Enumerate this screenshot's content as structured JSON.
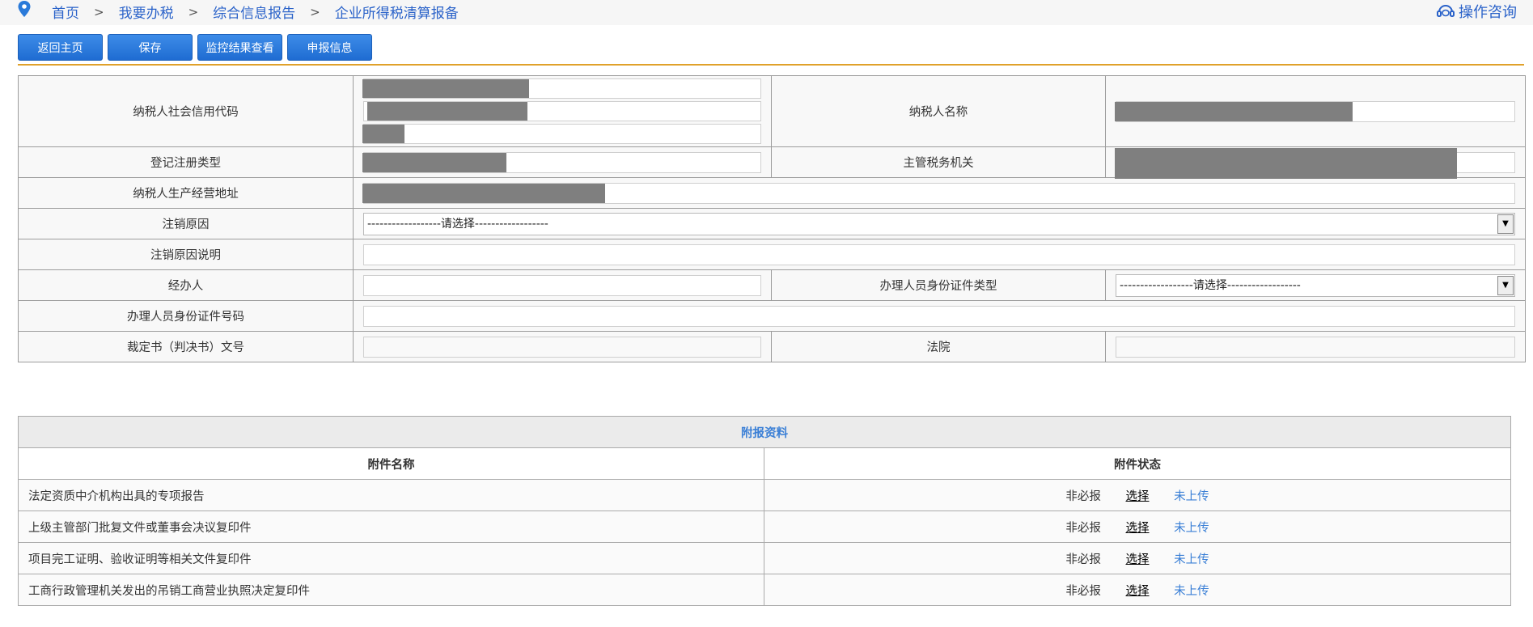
{
  "breadcrumb": {
    "items": [
      "首页",
      "我要办税",
      "综合信息报告",
      "企业所得税清算报备"
    ],
    "separator": ">"
  },
  "help": {
    "label": "操作咨询"
  },
  "toolbar": {
    "back_label": "返回主页",
    "save_label": "保存",
    "monitor_label": "监控结果查看",
    "declare_label": "申报信息"
  },
  "form": {
    "credit_code_label": "纳税人社会信用代码",
    "taxpayer_name_label": "纳税人名称",
    "reg_type_label": "登记注册类型",
    "tax_authority_label": "主管税务机关",
    "address_label": "纳税人生产经营地址",
    "cancel_reason_label": "注销原因",
    "cancel_reason_value": "------------------请选择------------------",
    "cancel_desc_label": "注销原因说明",
    "handler_label": "经办人",
    "id_type_label": "办理人员身份证件类型",
    "id_type_value": "------------------请选择------------------",
    "id_number_label": "办理人员身份证件号码",
    "ruling_label": "裁定书（判决书）文号",
    "court_label": "法院"
  },
  "attachments": {
    "title": "附报资料",
    "col_name": "附件名称",
    "col_status": "附件状态",
    "rows": [
      {
        "name": "法定资质中介机构出具的专项报告",
        "required": "非必报",
        "action": "选择",
        "status": "未上传"
      },
      {
        "name": "上级主管部门批复文件或董事会决议复印件",
        "required": "非必报",
        "action": "选择",
        "status": "未上传"
      },
      {
        "name": "项目完工证明、验收证明等相关文件复印件",
        "required": "非必报",
        "action": "选择",
        "status": "未上传"
      },
      {
        "name": "工商行政管理机关发出的吊销工商营业执照决定复印件",
        "required": "非必报",
        "action": "选择",
        "status": "未上传"
      }
    ]
  },
  "colors": {
    "accent": "#2a62c9",
    "button": "#2c7ad9",
    "divider": "#e0a12a",
    "link": "#3a7fd6"
  }
}
